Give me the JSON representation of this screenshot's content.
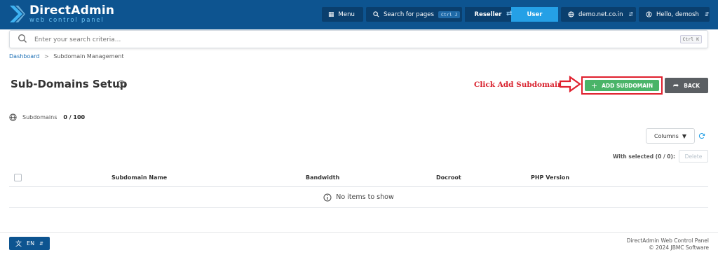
{
  "app": {
    "brand_title": "DirectAdmin",
    "brand_subtitle": "web control panel"
  },
  "topbar": {
    "menu_label": "Menu",
    "search_pages_label": "Search for pages",
    "search_pages_shortcut": "Ctrl J",
    "role_left": "Reseller",
    "role_right": "User",
    "domain_label": "demo.net.co.in",
    "user_label": "Hello, demosh"
  },
  "search": {
    "placeholder": "Enter your search criteria...",
    "shortcut": "Ctrl K"
  },
  "breadcrumb": {
    "items": [
      "Dashboard",
      "Subdomain Management"
    ],
    "separator": ">"
  },
  "page": {
    "title": "Sub-Domains Setup",
    "annotation": "Click Add Subdomain",
    "add_button": "ADD SUBDOMAIN",
    "back_button": "BACK"
  },
  "stats": {
    "label": "Subdomains",
    "value": "0 / 100"
  },
  "table": {
    "columns_button": "Columns",
    "with_selected": "With selected (0 / 0):",
    "delete_button": "Delete",
    "headers": [
      "Subdomain Name",
      "Bandwidth",
      "Docroot",
      "PHP Version"
    ],
    "empty_message": "No items to show"
  },
  "footer": {
    "language": "EN",
    "line1": "DirectAdmin Web Control Panel",
    "line2": "© 2024 JBMC Software"
  },
  "colors": {
    "header_bg": "#0d5490",
    "accent": "#25a0e6",
    "add_green": "#4ab468",
    "annotation_red": "#d9232f",
    "back_gray": "#5b5f63"
  },
  "icons": {
    "logo": "directadmin-chevron-icon",
    "menu": "grid-icon",
    "search_pages": "search-icon",
    "role_switch": "swap-arrows-icon",
    "domain": "globe-icon",
    "user": "user-circle-icon",
    "help": "question-circle-icon",
    "add": "plus-icon",
    "back": "share-arrow-icon",
    "stats": "globe-icon",
    "refresh": "refresh-icon",
    "info": "info-circle-icon",
    "language": "translate-icon"
  }
}
